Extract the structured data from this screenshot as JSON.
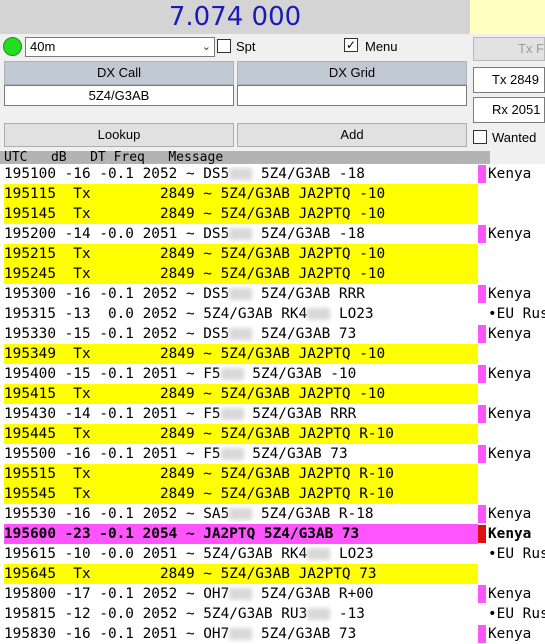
{
  "frequency": "7.074 000",
  "band": {
    "value": "40m"
  },
  "spt": {
    "label": "Spt",
    "checked": false
  },
  "menu": {
    "label": "Menu",
    "checked": true
  },
  "tx_button": {
    "label": "Tx F"
  },
  "dx_call": {
    "label": "DX Call",
    "value": "5Z4/G3AB"
  },
  "dx_grid": {
    "label": "DX Grid",
    "value": ""
  },
  "tx_freq": {
    "label": "Tx 2849"
  },
  "rx_freq": {
    "label": "Rx 2051"
  },
  "lookup": {
    "label": "Lookup"
  },
  "add": {
    "label": "Add"
  },
  "wanted": {
    "label": "Wanted",
    "checked": false
  },
  "header": "UTC   dB   DT Freq   Message",
  "colors": {
    "tx_row": "#ffff00",
    "my_call_row": "#ff55ff",
    "country_bar_pink": "#ff55ff",
    "country_bar_red": "#dd1111"
  },
  "rows": [
    {
      "type": "rx",
      "text": "195100 -16 -0.1 2052 ~ DS5",
      "blurred": true,
      "tail": " 5Z4/G3AB -18",
      "country": "Kenya",
      "bar": "pink"
    },
    {
      "type": "tx",
      "text": "195115  Tx        2849 ~ 5Z4/G3AB JA2PTQ -10"
    },
    {
      "type": "tx",
      "text": "195145  Tx        2849 ~ 5Z4/G3AB JA2PTQ -10"
    },
    {
      "type": "rx",
      "text": "195200 -14 -0.0 2051 ~ DS5",
      "blurred": true,
      "tail": " 5Z4/G3AB -18",
      "country": "Kenya",
      "bar": "pink"
    },
    {
      "type": "tx",
      "text": "195215  Tx        2849 ~ 5Z4/G3AB JA2PTQ -10"
    },
    {
      "type": "tx",
      "text": "195245  Tx        2849 ~ 5Z4/G3AB JA2PTQ -10"
    },
    {
      "type": "rx",
      "text": "195300 -16 -0.1 2052 ~ DS5",
      "blurred": true,
      "tail": " 5Z4/G3AB RRR",
      "country": "Kenya",
      "bar": "pink"
    },
    {
      "type": "rx",
      "text": "195315 -13  0.0 2052 ~ 5Z4/G3AB RK4",
      "blurred": true,
      "tail": " LO23",
      "country": "•EU Rus",
      "bar": "none"
    },
    {
      "type": "rx",
      "text": "195330 -15 -0.1 2052 ~ DS5",
      "blurred": true,
      "tail": " 5Z4/G3AB 73",
      "country": "Kenya",
      "bar": "pink"
    },
    {
      "type": "tx",
      "text": "195349  Tx        2849 ~ 5Z4/G3AB JA2PTQ -10"
    },
    {
      "type": "rx",
      "text": "195400 -15 -0.1 2051 ~ F5",
      "blurred": true,
      "tail": " 5Z4/G3AB -10",
      "country": "Kenya",
      "bar": "pink"
    },
    {
      "type": "tx",
      "text": "195415  Tx        2849 ~ 5Z4/G3AB JA2PTQ -10"
    },
    {
      "type": "rx",
      "text": "195430 -14 -0.1 2051 ~ F5",
      "blurred": true,
      "tail": " 5Z4/G3AB RRR",
      "country": "Kenya",
      "bar": "pink"
    },
    {
      "type": "tx",
      "text": "195445  Tx        2849 ~ 5Z4/G3AB JA2PTQ R-10"
    },
    {
      "type": "rx",
      "text": "195500 -16 -0.1 2051 ~ F5",
      "blurred": true,
      "tail": " 5Z4/G3AB 73",
      "country": "Kenya",
      "bar": "pink"
    },
    {
      "type": "tx",
      "text": "195515  Tx        2849 ~ 5Z4/G3AB JA2PTQ R-10"
    },
    {
      "type": "tx",
      "text": "195545  Tx        2849 ~ 5Z4/G3AB JA2PTQ R-10"
    },
    {
      "type": "rx",
      "text": "195530 -16 -0.1 2052 ~ SA5",
      "blurred": true,
      "tail": " 5Z4/G3AB R-18",
      "country": "Kenya",
      "bar": "pink"
    },
    {
      "type": "me",
      "text": "195600 -23 -0.1 2054 ~ JA2PTQ 5Z4/G3AB 73",
      "country": "Kenya",
      "bar": "red"
    },
    {
      "type": "rx",
      "text": "195615 -10 -0.0 2051 ~ 5Z4/G3AB RK4",
      "blurred": true,
      "tail": " LO23",
      "country": "•EU Rus",
      "bar": "none"
    },
    {
      "type": "tx",
      "text": "195645  Tx        2849 ~ 5Z4/G3AB JA2PTQ 73"
    },
    {
      "type": "rx",
      "text": "195800 -17 -0.1 2052 ~ OH7",
      "blurred": true,
      "tail": " 5Z4/G3AB R+00",
      "country": "Kenya",
      "bar": "pink"
    },
    {
      "type": "rx",
      "text": "195815 -12 -0.0 2052 ~ 5Z4/G3AB RU3",
      "blurred": true,
      "tail": " -13",
      "country": "•EU Rus",
      "bar": "none"
    },
    {
      "type": "rx",
      "text": "195830 -16 -0.1 2051 ~ OH7",
      "blurred": true,
      "tail": " 5Z4/G3AB 73",
      "country": "Kenya",
      "bar": "pink"
    }
  ]
}
